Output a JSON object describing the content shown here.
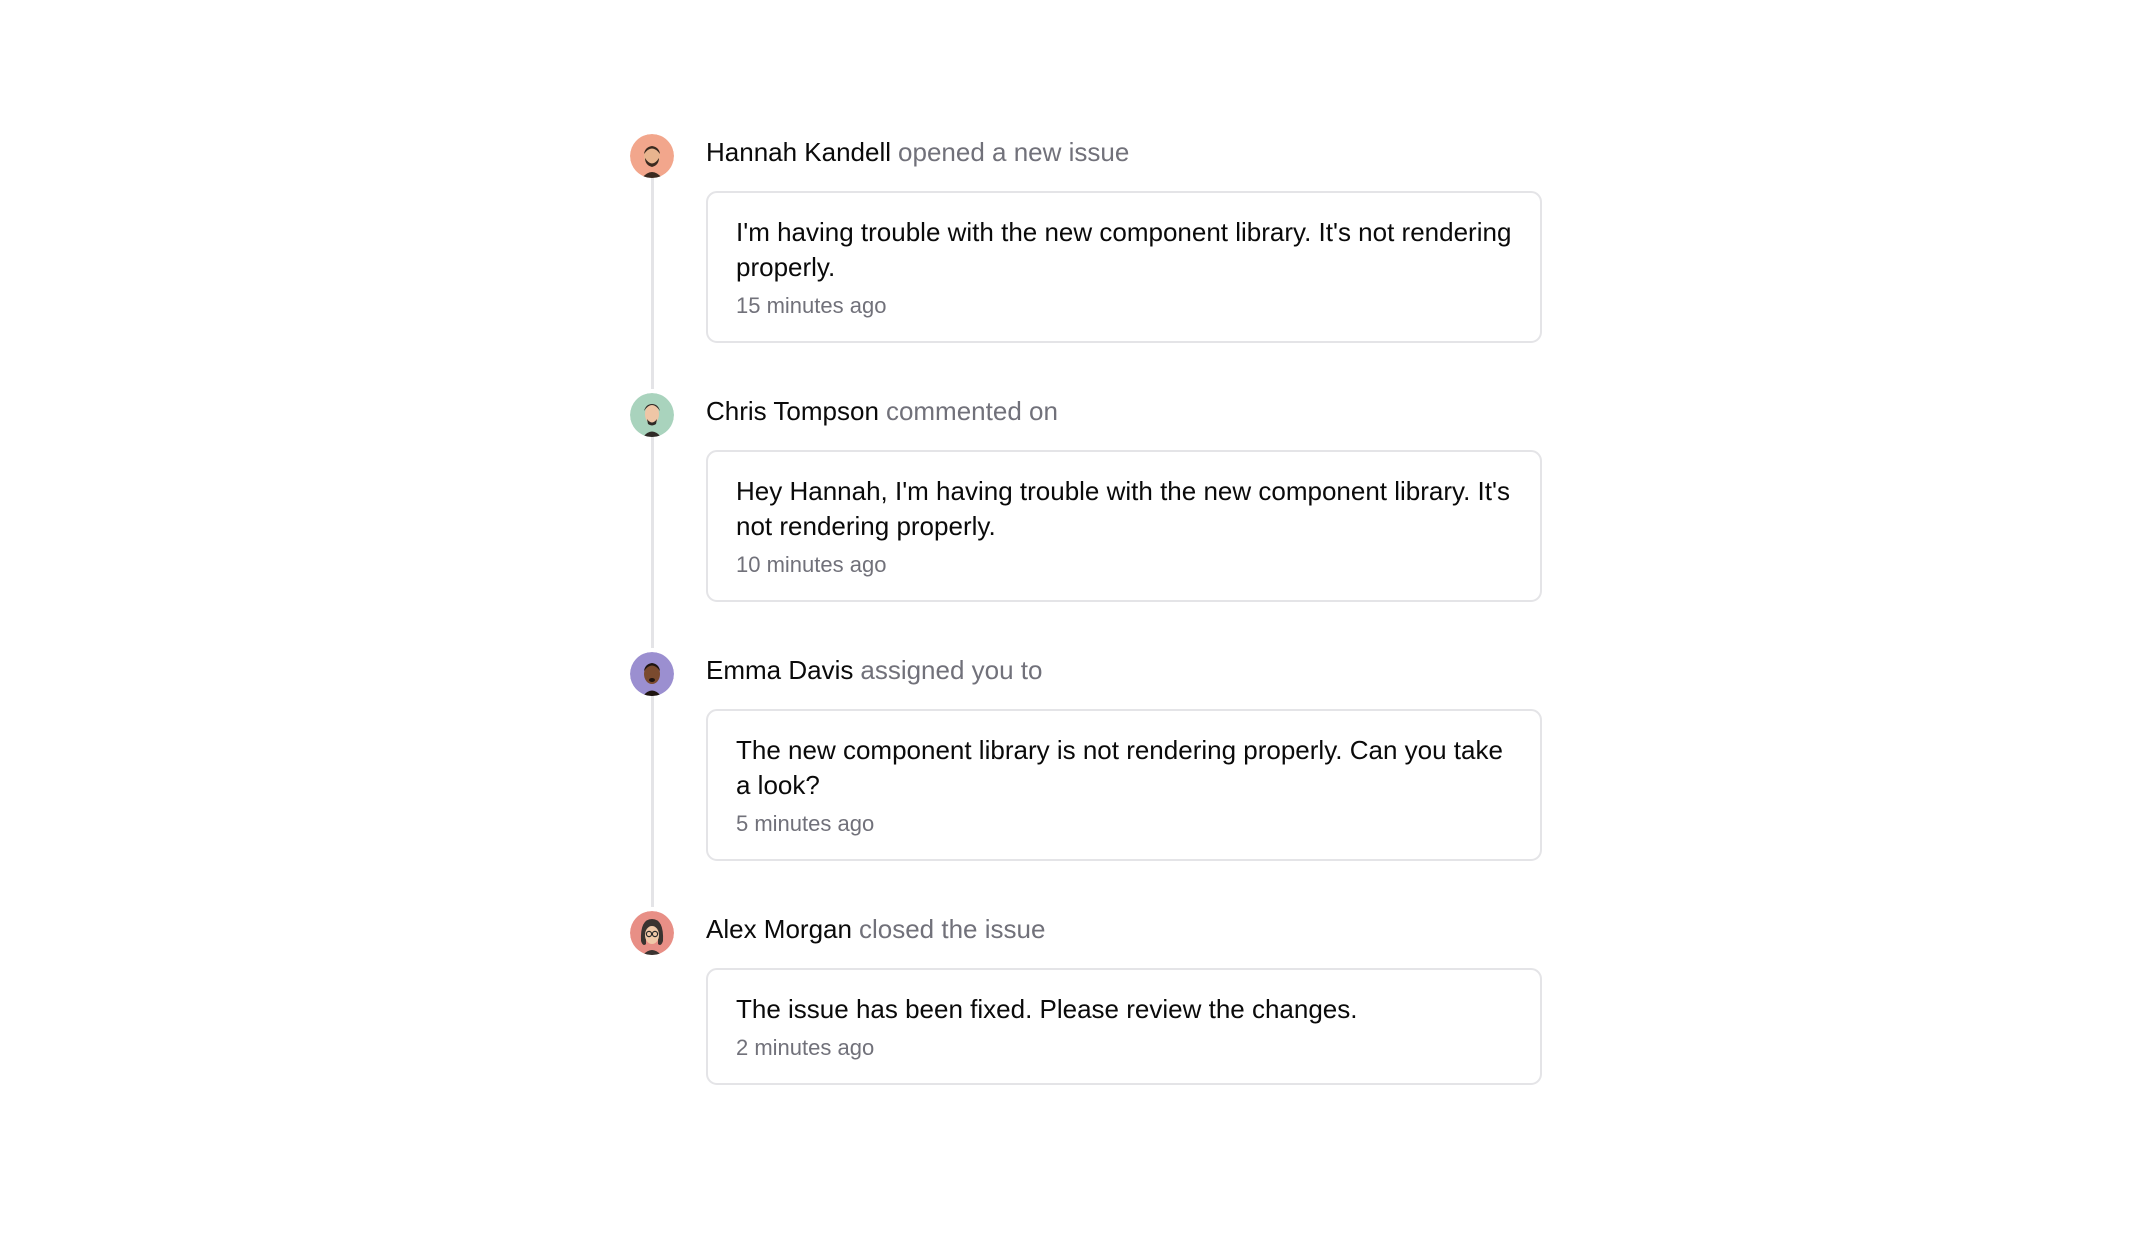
{
  "events": [
    {
      "actor": "Hannah Kandell",
      "action": "opened a new issue",
      "message": "I'm having trouble with the new component library. It's not rendering properly.",
      "time": "15 minutes ago",
      "avatar": {
        "bg": "#f2a68c",
        "skin": "#e8b48e",
        "hair": "#3b2a20"
      }
    },
    {
      "actor": "Chris Tompson",
      "action": "commented on",
      "message": "Hey Hannah, I'm having trouble with the new component library. It's not rendering properly.",
      "time": "10 minutes ago",
      "avatar": {
        "bg": "#a9d3bd",
        "skin": "#efc6a6",
        "hair": "#2f2a26"
      }
    },
    {
      "actor": "Emma Davis",
      "action": "assigned you to",
      "message": "The new component library is not rendering properly. Can you take a look?",
      "time": "5 minutes ago",
      "avatar": {
        "bg": "#9b8fd0",
        "skin": "#7a4a2e",
        "hair": "#1e1410"
      }
    },
    {
      "actor": "Alex Morgan",
      "action": "closed the issue",
      "message": "The issue has been fixed. Please review the changes.",
      "time": "2 minutes ago",
      "avatar": {
        "bg": "#e88f86",
        "skin": "#f0c9a8",
        "hair": "#3a3330"
      }
    }
  ],
  "colors": {
    "text": "#0a0a0a",
    "muted": "#71717a",
    "border": "#e4e4e7"
  },
  "icons": [
    "user-avatar-icon"
  ]
}
